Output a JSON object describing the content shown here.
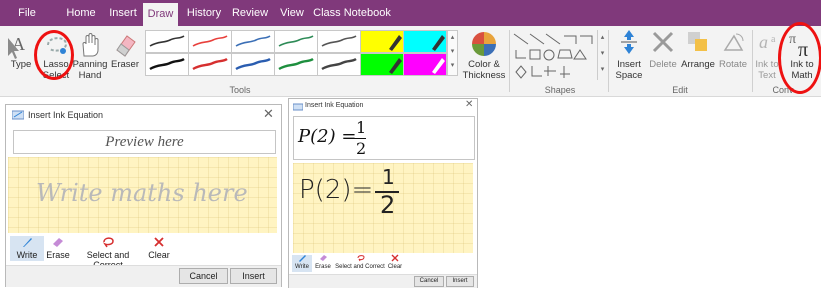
{
  "menu": {
    "tabs": [
      "File",
      "Home",
      "Insert",
      "Draw",
      "History",
      "Review",
      "View",
      "Class Notebook"
    ],
    "active": "Draw"
  },
  "ribbon": {
    "type_label": "Type",
    "lasso_label_1": "Lasso",
    "lasso_label_2": "Select",
    "panning_label_1": "Panning",
    "panning_label_2": "Hand",
    "eraser_label": "Eraser",
    "color_thickness_1": "Color &",
    "color_thickness_2": "Thickness",
    "insert_space_1": "Insert",
    "insert_space_2": "Space",
    "delete_label": "Delete",
    "arrange_label": "Arrange",
    "rotate_label": "Rotate",
    "ink_to_text_1": "Ink to",
    "ink_to_text_2": "Text",
    "ink_to_math_1": "Ink to",
    "ink_to_math_2": "Math",
    "group_tools": "Tools",
    "group_shapes": "Shapes",
    "group_edit": "Edit",
    "group_convert": "Conv",
    "pen_colors": [
      "#333333",
      "#e8403c",
      "#3b6fb6",
      "#2e8b57",
      "#555555"
    ],
    "pen_colors_row2": [
      "#111111",
      "#d62f2f",
      "#2a5db0",
      "#1e8f3e",
      "#444444"
    ],
    "highlighter_colors": [
      "#ffff00",
      "#00ffff",
      "#00ff00",
      "#ff00ff"
    ]
  },
  "dialog_left": {
    "title": "Insert Ink Equation",
    "preview": "Preview here",
    "pad_text": "Write maths here",
    "tools": {
      "write": "Write",
      "erase": "Erase",
      "select": "Select and Correct",
      "clear": "Clear"
    },
    "cancel": "Cancel",
    "insert": "Insert"
  },
  "dialog_right": {
    "title": "Insert Ink Equation",
    "preview_lhs": "P(2) =",
    "preview_num": "1",
    "preview_den": "2",
    "pad_lhs": "P(2)=",
    "pad_num": "1",
    "pad_den": "2",
    "tools": {
      "write": "Write",
      "erase": "Erase",
      "select": "Select and Correct",
      "clear": "Clear"
    },
    "cancel": "Cancel",
    "insert": "Insert"
  }
}
